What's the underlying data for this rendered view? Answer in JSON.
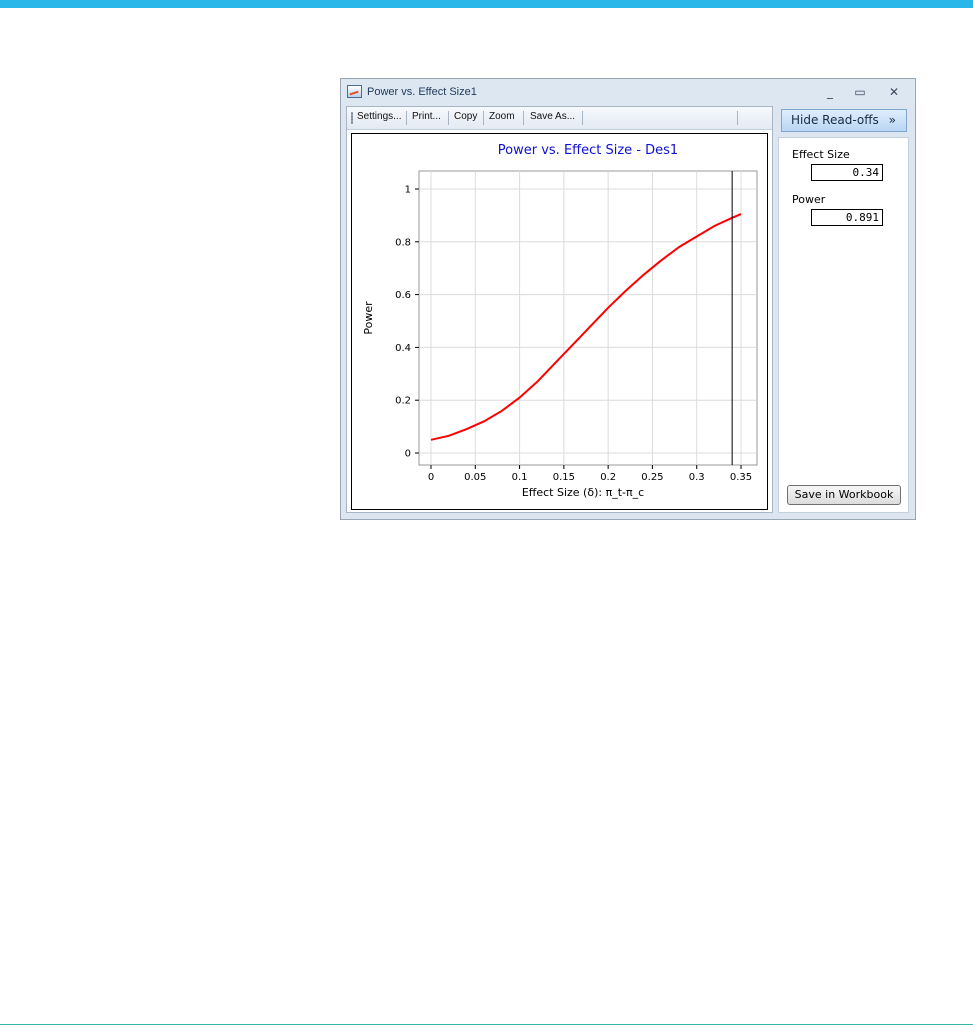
{
  "window": {
    "title": "Power vs. Effect Size1",
    "minimize_glyph": "_",
    "maximize_glyph": "▭",
    "close_glyph": "✕"
  },
  "toolbar": {
    "settings_label": "Settings...",
    "print_label": "Print...",
    "copy_label": "Copy",
    "zoom_label": "Zoom",
    "save_as_label": "Save As..."
  },
  "sidebar": {
    "hide_readoffs_label": "Hide Read-offs",
    "hide_readoffs_chevron": "»",
    "effect_size_label": "Effect Size",
    "effect_size_value": "0.34",
    "power_label": "Power",
    "power_value": "0.891",
    "save_workbook_label": "Save in Workbook"
  },
  "colors": {
    "title_blue": "#1010d0",
    "curve_red": "#ff0000",
    "accent_bar": "#29b6e8"
  },
  "chart_data": {
    "type": "line",
    "title": "Power vs. Effect Size - Des1",
    "xlabel": "Effect Size (δ): π_t-π_c",
    "ylabel": "Power",
    "xlim": [
      0,
      0.35
    ],
    "ylim": [
      0,
      1
    ],
    "x_ticks": [
      "0",
      "0.05",
      "0.1",
      "0.15",
      "0.2",
      "0.25",
      "0.3",
      "0.35"
    ],
    "y_ticks": [
      "0",
      "0.2",
      "0.4",
      "0.6",
      "0.8",
      "1"
    ],
    "grid": true,
    "readoff_x": 0.34,
    "series": [
      {
        "x": [
          0,
          0.02,
          0.04,
          0.06,
          0.08,
          0.1,
          0.12,
          0.14,
          0.16,
          0.18,
          0.2,
          0.22,
          0.24,
          0.26,
          0.28,
          0.3,
          0.32,
          0.34,
          0.35
        ],
        "y": [
          0.05,
          0.065,
          0.09,
          0.12,
          0.16,
          0.21,
          0.27,
          0.34,
          0.41,
          0.48,
          0.55,
          0.615,
          0.675,
          0.73,
          0.78,
          0.82,
          0.86,
          0.891,
          0.905
        ]
      }
    ]
  }
}
